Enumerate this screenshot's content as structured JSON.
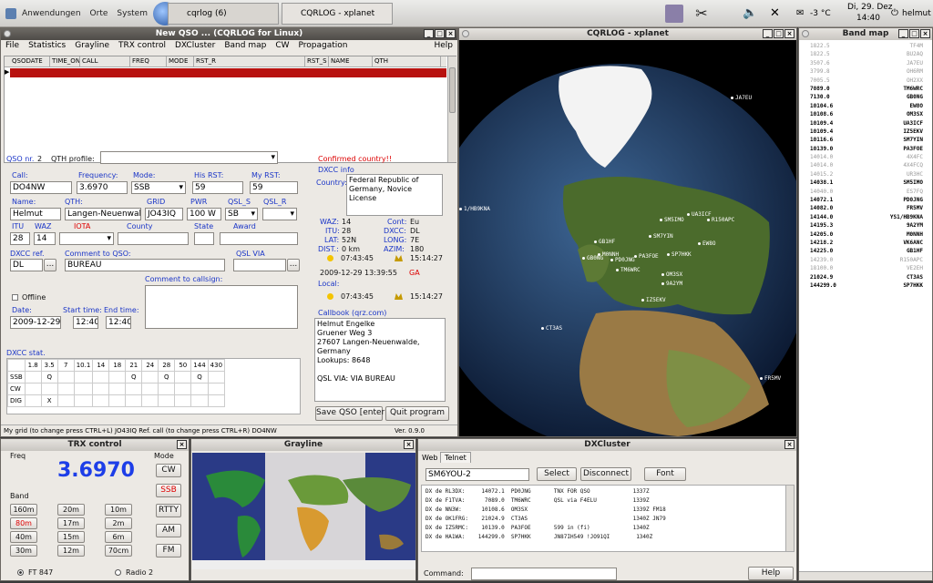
{
  "top_panel": {
    "menus": [
      "Anwendungen",
      "Orte",
      "System"
    ],
    "tasks": [
      "cqrlog (6)",
      "CQRLOG - xplanet"
    ],
    "temperature": "-3 °C",
    "date": "Di, 29. Dez",
    "time": "14:40",
    "user": "helmut"
  },
  "qso_window": {
    "title": "New QSO ... (CQRLOG for Linux)",
    "menu": [
      "File",
      "Statistics",
      "Grayline",
      "TRX control",
      "DXCluster",
      "Band map",
      "CW",
      "Propagation",
      "Help"
    ],
    "columns": [
      "QSODATE",
      "TIME_ON",
      "CALL",
      "FREQ",
      "MODE",
      "RST_R",
      "RST_S",
      "NAME",
      "QTH"
    ],
    "qso_nr_label": "QSO nr.",
    "qso_nr": "2",
    "qth_profile_label": "QTH profile:",
    "confirmed": "Confirmed country!!",
    "labels": {
      "call": "Call:",
      "freq": "Frequency:",
      "mode": "Mode:",
      "his_rst": "His RST:",
      "my_rst": "My RST:",
      "name": "Name:",
      "qth": "QTH:",
      "grid": "GRID",
      "pwr": "PWR",
      "qsl_s": "QSL_S",
      "qsl_r": "QSL_R",
      "itu": "ITU",
      "waz": "WAZ",
      "iota": "IOTA",
      "county": "County",
      "state": "State",
      "award": "Award",
      "dxcc_ref": "DXCC ref.",
      "comment_qso": "Comment to QSO:",
      "qsl_via": "QSL VIA",
      "comment_call": "Comment to callsign:",
      "offline": "Offline",
      "date": "Date:",
      "start": "Start time:",
      "end": "End time:"
    },
    "values": {
      "call": "DO4NW",
      "freq": "3.6970",
      "mode": "SSB",
      "his_rst": "59",
      "my_rst": "59",
      "name": "Helmut",
      "qth": "Langen-Neuenwalde",
      "grid": "JO43IQ",
      "pwr": "100 W",
      "qsl_s": "SB",
      "itu": "28",
      "waz": "14",
      "dxcc_ref": "DL",
      "comment_qso": "BUREAU",
      "date": "2009-12-29",
      "start": "12:40",
      "end": "12:40"
    },
    "dxcc_info": {
      "title": "DXCC info",
      "country_label": "Country:",
      "country": "Federal Republic of Germany, Novice License",
      "waz_label": "WAZ:",
      "waz": "14",
      "itu_label": "ITU:",
      "itu": "28",
      "lat_label": "LAT:",
      "lat": "52N",
      "dist_label": "DIST.:",
      "dist": "0 km",
      "cont_label": "Cont:",
      "cont": "Eu",
      "dxcc_label": "DXCC:",
      "dxcc": "DL",
      "long_label": "LONG:",
      "long": "7E",
      "azim_label": "AZIM:",
      "azim": "180",
      "sunrise": "07:43:45",
      "sunset": "15:14:27",
      "datetime": "2009-12-29  13:39:55",
      "ga": "GA",
      "local_label": "Local:",
      "local_sunrise": "07:43:45",
      "local_sunset": "15:14:27"
    },
    "callbook": {
      "title": "Callbook (qrz.com)",
      "lines": [
        "Helmut Engelke",
        "Gruener Weg 3",
        "27607 Langen-Neuenwalde,",
        "Germany",
        "Lookups:    8648",
        "",
        "QSL VIA: VIA BUREAU"
      ]
    },
    "dxcc_stat": {
      "title": "DXCC stat.",
      "bands": [
        "1.8",
        "3.5",
        "7",
        "10.1",
        "14",
        "18",
        "21",
        "24",
        "28",
        "50",
        "144",
        "430"
      ],
      "rows": [
        {
          "mode": "SSB",
          "cells": [
            "",
            "Q",
            "",
            "",
            "",
            "",
            "Q",
            "",
            "Q",
            "",
            "Q",
            ""
          ]
        },
        {
          "mode": "CW",
          "cells": [
            "",
            "",
            "",
            "",
            "",
            "",
            "",
            "",
            "",
            "",
            "",
            ""
          ]
        },
        {
          "mode": "DIG",
          "cells": [
            "",
            "X",
            "",
            "",
            "",
            "",
            "",
            "",
            "",
            "",
            "",
            ""
          ]
        }
      ]
    },
    "save_btn": "Save QSO [enter]",
    "quit_btn": "Quit program",
    "status": "My grid (to change press CTRL+L) JO43IQ   Ref. call (to change press CTRL+R)   DO4NW",
    "version": "Ver. 0.9.0"
  },
  "xplanet": {
    "title": "CQRLOG - xplanet",
    "spots": [
      "JA7EU",
      "1/HB9KNA",
      "UA3ICF",
      "R150APC",
      "SM5IMO",
      "SM7YIN",
      "EW8O",
      "GB1HF",
      "M0NNH",
      "PD0JNG",
      "GB0NG",
      "PA3FOE",
      "SP7HKK",
      "TM6WRC",
      "OM3SX",
      "9A2YM",
      "IZ5EKV",
      "CT3AS",
      "FR5MV"
    ]
  },
  "band_map": {
    "title": "Band map",
    "rows": [
      [
        "1822.5",
        "TF4M"
      ],
      [
        "1822.5",
        "BU2AQ"
      ],
      [
        "3507.6",
        "JA7EU"
      ],
      [
        "3799.8",
        "OH6RM"
      ],
      [
        "7005.5",
        "OH2XX"
      ],
      [
        "7089.0",
        "TM6WRC"
      ],
      [
        "7130.0",
        "GB0NG"
      ],
      [
        "10104.6",
        "EW8O"
      ],
      [
        "10108.6",
        "OM3SX"
      ],
      [
        "10109.4",
        "UA3ICF"
      ],
      [
        "10109.4",
        "IZ5EKV"
      ],
      [
        "10116.6",
        "SM7YIN"
      ],
      [
        "10139.0",
        "PA3FOE"
      ],
      [
        "14014.0",
        "4X4FC"
      ],
      [
        "14014.0",
        "4X4FCQ"
      ],
      [
        "14015.2",
        "UR3HC"
      ],
      [
        "14038.1",
        "SM5IMO"
      ],
      [
        "14040.0",
        "ES7FQ"
      ],
      [
        "14072.1",
        "PD0JNG"
      ],
      [
        "14082.0",
        "FR5MV"
      ],
      [
        "14144.0",
        "YS1/HB9KNA"
      ],
      [
        "14195.3",
        "9A2YM"
      ],
      [
        "14205.0",
        "M0NNH"
      ],
      [
        "14218.2",
        "VK6ANC"
      ],
      [
        "14225.0",
        "GB1HF"
      ],
      [
        "14239.0",
        "R150APC"
      ],
      [
        "18100.0",
        "VE2EH"
      ],
      [
        "21024.9",
        "CT3AS"
      ],
      [
        "144299.0",
        "SP7HKK"
      ]
    ]
  },
  "trx": {
    "title": "TRX control",
    "freq_label": "Freq",
    "freq": "3.6970",
    "mode_label": "Mode",
    "modes": [
      "CW",
      "SSB",
      "RTTY",
      "AM",
      "FM"
    ],
    "band_label": "Band",
    "bands": [
      "160m",
      "20m",
      "10m",
      "80m",
      "17m",
      "2m",
      "40m",
      "15m",
      "6m",
      "30m",
      "12m",
      "70cm"
    ],
    "radio1": "FT 847",
    "radio2": "Radio 2"
  },
  "grayline": {
    "title": "Grayline"
  },
  "dxcluster": {
    "title": "DXCluster",
    "tabs": [
      "Web",
      "Telnet"
    ],
    "server": "SM6YOU-2",
    "select_btn": "Select",
    "disconnect_btn": "Disconnect",
    "font_btn": "Font",
    "lines": [
      "DX de RL3DX:     14072.1  PD0JNG       TNX FOR QSO             1337Z",
      "DX de F1TVA:      7089.0  TM6WRC       QSL via F4ELU           1339Z",
      "DX de NN3W:      10108.6  OM3SX                                1339Z FM18",
      "DX de OK1FRG:    21024.9  CT3AS                                1340Z JN79",
      "DX de IZ5RMC:    10139.0  PA3FOE       599 in (fi)             1340Z",
      "DX de HA1WA:    144299.0  SP7HKK       JN87IH549 !JO91QI        1340Z"
    ],
    "command_label": "Command:",
    "help_btn": "Help"
  }
}
